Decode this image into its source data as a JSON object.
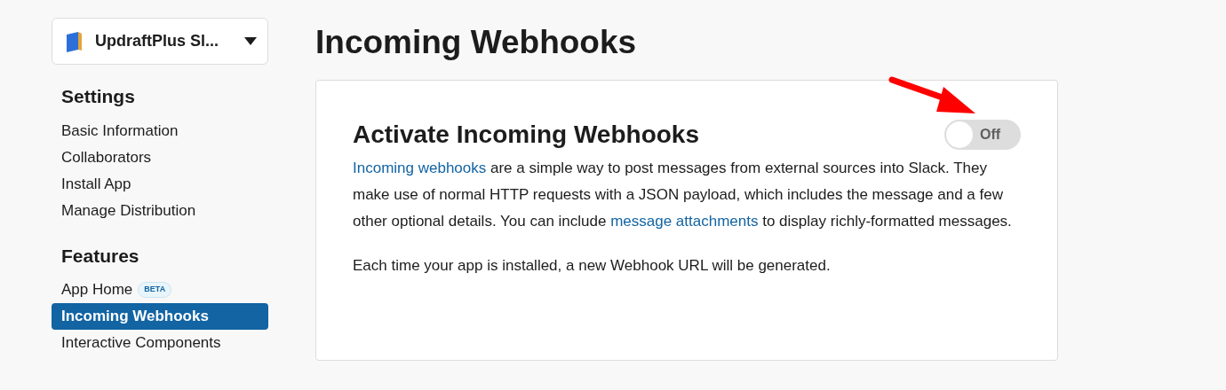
{
  "workspace": {
    "name": "UpdraftPlus Sl..."
  },
  "sidebar": {
    "sections": [
      {
        "heading": "Settings",
        "items": [
          {
            "label": "Basic Information",
            "selected": false
          },
          {
            "label": "Collaborators",
            "selected": false
          },
          {
            "label": "Install App",
            "selected": false
          },
          {
            "label": "Manage Distribution",
            "selected": false
          }
        ]
      },
      {
        "heading": "Features",
        "items": [
          {
            "label": "App Home",
            "badge": "BETA",
            "selected": false
          },
          {
            "label": "Incoming Webhooks",
            "selected": true
          },
          {
            "label": "Interactive Components",
            "selected": false
          }
        ]
      }
    ]
  },
  "page": {
    "title": "Incoming Webhooks"
  },
  "card": {
    "heading": "Activate Incoming Webhooks",
    "toggle": {
      "on": false,
      "label": "Off"
    },
    "paragraphs": [
      [
        {
          "kind": "link",
          "text": "Incoming webhooks"
        },
        {
          "kind": "text",
          "text": " are a simple way to post messages from external sources into Slack. They make use of normal HTTP requests with a JSON payload, which includes the message and a few other optional details. You can include "
        },
        {
          "kind": "link",
          "text": "message attachments"
        },
        {
          "kind": "text",
          "text": " to display richly-formatted messages."
        }
      ],
      [
        {
          "kind": "text",
          "text": "Each time your app is installed, a new Webhook URL will be generated."
        }
      ]
    ]
  }
}
